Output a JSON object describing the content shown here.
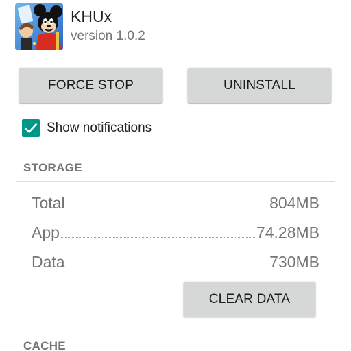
{
  "app": {
    "title": "KHUx",
    "version": "version 1.0.2"
  },
  "buttons": {
    "force_stop": "FORCE STOP",
    "uninstall": "UNINSTALL",
    "clear_data": "CLEAR DATA"
  },
  "notifications": {
    "label": "Show notifications",
    "checked": true
  },
  "storage": {
    "header": "STORAGE",
    "rows": [
      {
        "label": "Total",
        "value": "804MB"
      },
      {
        "label": "App",
        "value": "74.28MB"
      },
      {
        "label": "Data",
        "value": "730MB"
      }
    ]
  },
  "cache": {
    "header": "CACHE"
  },
  "colors": {
    "accent": "#009688",
    "button_bg": "#d6d7d7",
    "secondary_text": "#757575"
  }
}
